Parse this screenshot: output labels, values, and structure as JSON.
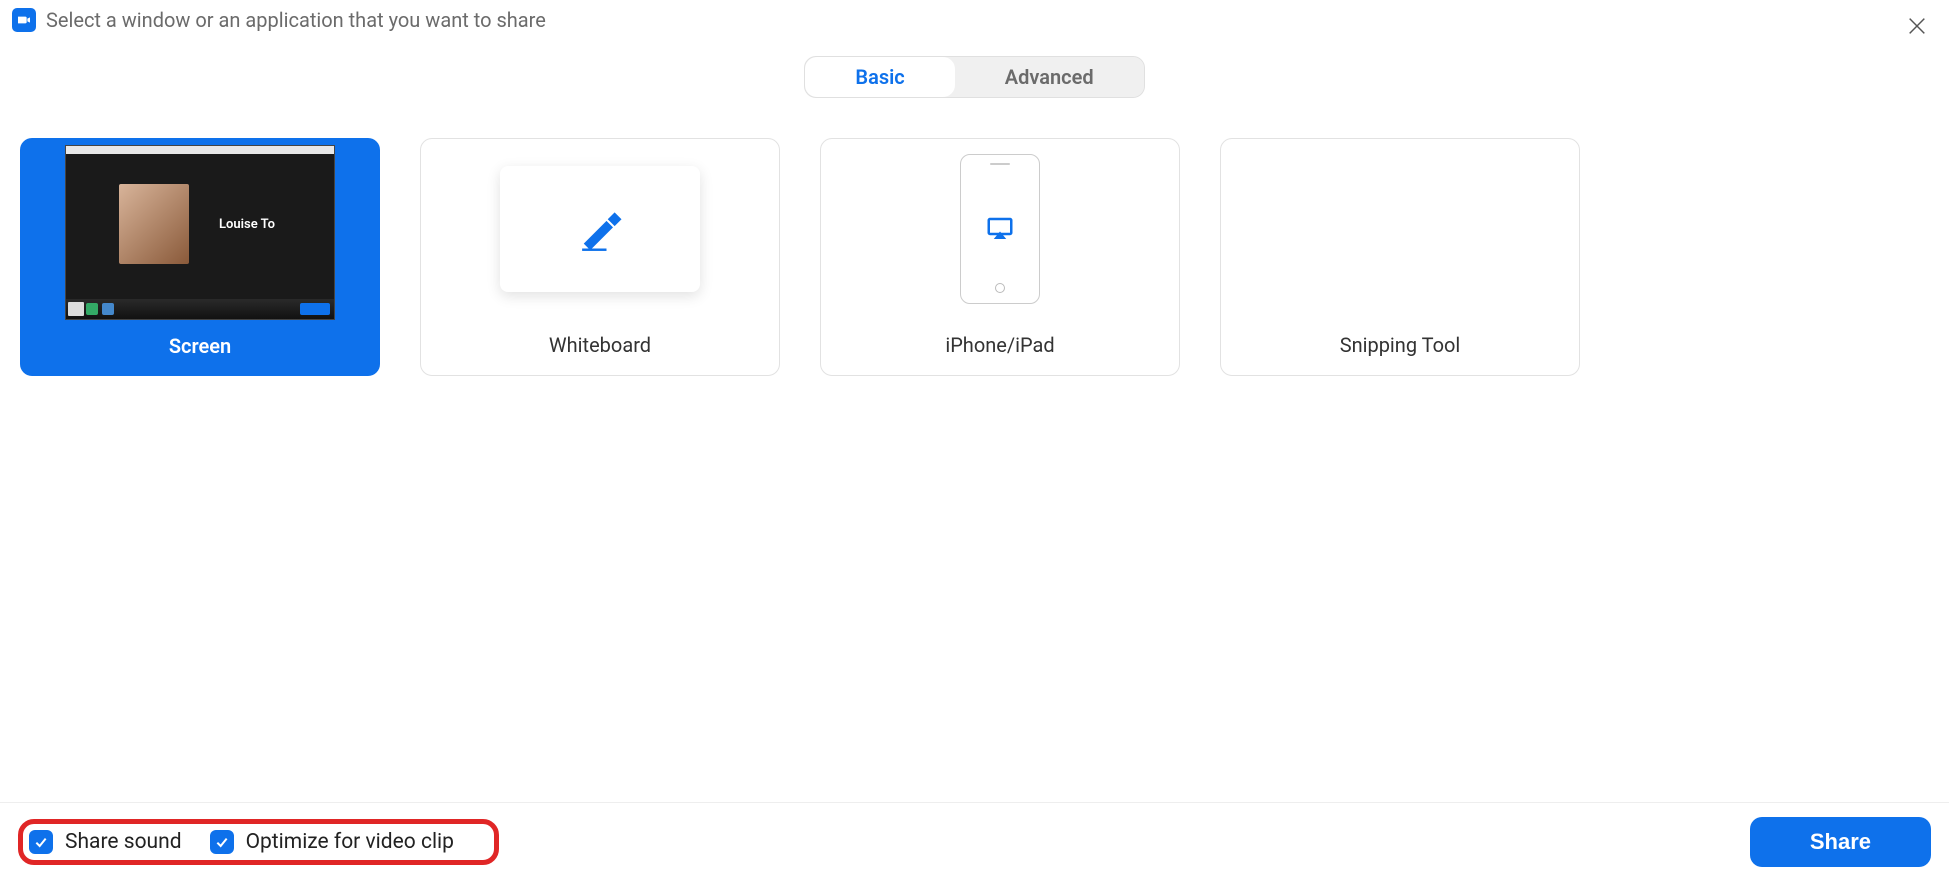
{
  "header": {
    "title": "Select a window or an application that you want to share"
  },
  "tabs": {
    "basic": "Basic",
    "advanced": "Advanced",
    "active": "basic"
  },
  "tiles": {
    "screen": {
      "label": "Screen",
      "preview_name": "Louise To",
      "selected": true
    },
    "whiteboard": {
      "label": "Whiteboard"
    },
    "iphone": {
      "label": "iPhone/iPad"
    },
    "snipping": {
      "label": "Snipping Tool"
    }
  },
  "footer": {
    "share_sound": {
      "label": "Share sound",
      "checked": true
    },
    "optimize_video": {
      "label": "Optimize for video clip",
      "checked": true
    },
    "share_button": "Share"
  },
  "colors": {
    "accent": "#0e71eb",
    "highlight": "#e02626"
  }
}
